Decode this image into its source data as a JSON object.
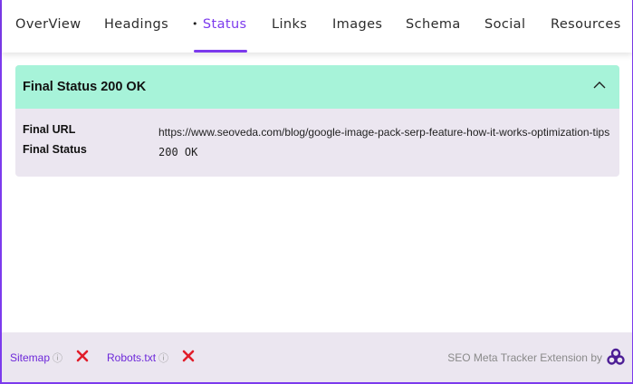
{
  "tabs": {
    "items": [
      {
        "label": "OverView"
      },
      {
        "label": "Headings"
      },
      {
        "label": "Status"
      },
      {
        "label": "Links"
      },
      {
        "label": "Images"
      },
      {
        "label": "Schema"
      },
      {
        "label": "Social"
      },
      {
        "label": "Resources"
      }
    ],
    "active_marker": "•",
    "active_index": 2
  },
  "panel": {
    "title": "Final Status 200 OK",
    "rows": {
      "url_label": "Final URL",
      "url_value": "https://www.seoveda.com/blog/google-image-pack-serp-feature-how-it-works-optimization-tips",
      "status_label": "Final Status",
      "status_value": "200 OK"
    },
    "header_color": "#a7f3d9",
    "collapse_icon": "chevron-up-icon"
  },
  "footer": {
    "sitemap_label": "Sitemap",
    "robots_label": "Robots.txt",
    "info_glyph": "ⓘ",
    "sitemap_status_icon": "x-icon",
    "robots_status_icon": "x-icon",
    "brand_text": "SEO Meta Tracker Extension by",
    "status_color": "#e11d2a",
    "accent": "#7c3aed"
  }
}
